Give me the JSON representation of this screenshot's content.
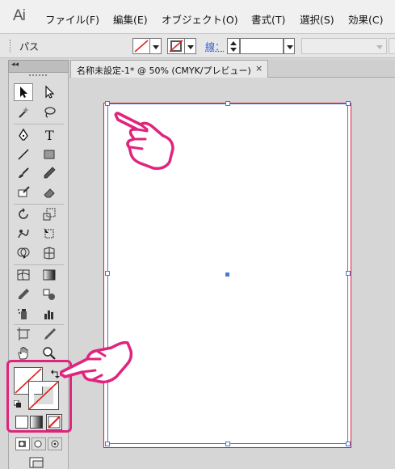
{
  "app": {
    "logo": "Ai"
  },
  "menubar": {
    "items": [
      {
        "label": "ファイル(F)"
      },
      {
        "label": "編集(E)"
      },
      {
        "label": "オブジェクト(O)"
      },
      {
        "label": "書式(T)"
      },
      {
        "label": "選択(S)"
      },
      {
        "label": "効果(C)"
      }
    ]
  },
  "control_bar": {
    "object_type": "パス",
    "stroke_label": "線："
  },
  "tools_panel": {
    "collapse_glyph": "◂◂"
  },
  "document": {
    "tab_title": "名称未設定-1* @ 50% (CMYK/プレビュー)",
    "close_glyph": "×"
  },
  "colors": {
    "highlight": "#e0247e",
    "artboard_border": "#d8203e",
    "selection": "#4a78d6",
    "none_slash": "#e02020"
  },
  "icons": [
    "selection-tool-icon",
    "direct-selection-tool-icon",
    "magic-wand-icon",
    "lasso-icon",
    "pen-icon",
    "type-icon",
    "line-icon",
    "rectangle-icon",
    "paintbrush-icon",
    "pencil-icon",
    "blob-brush-icon",
    "eraser-icon",
    "rotate-icon",
    "scale-icon",
    "warp-icon",
    "free-transform-icon",
    "shape-builder-icon",
    "perspective-grid-icon",
    "mesh-icon",
    "gradient-icon",
    "eyedropper-icon",
    "blend-icon",
    "symbol-sprayer-icon",
    "graph-icon",
    "artboard-icon",
    "slice-icon",
    "hand-icon",
    "zoom-icon",
    "pointing-hand-icon"
  ]
}
